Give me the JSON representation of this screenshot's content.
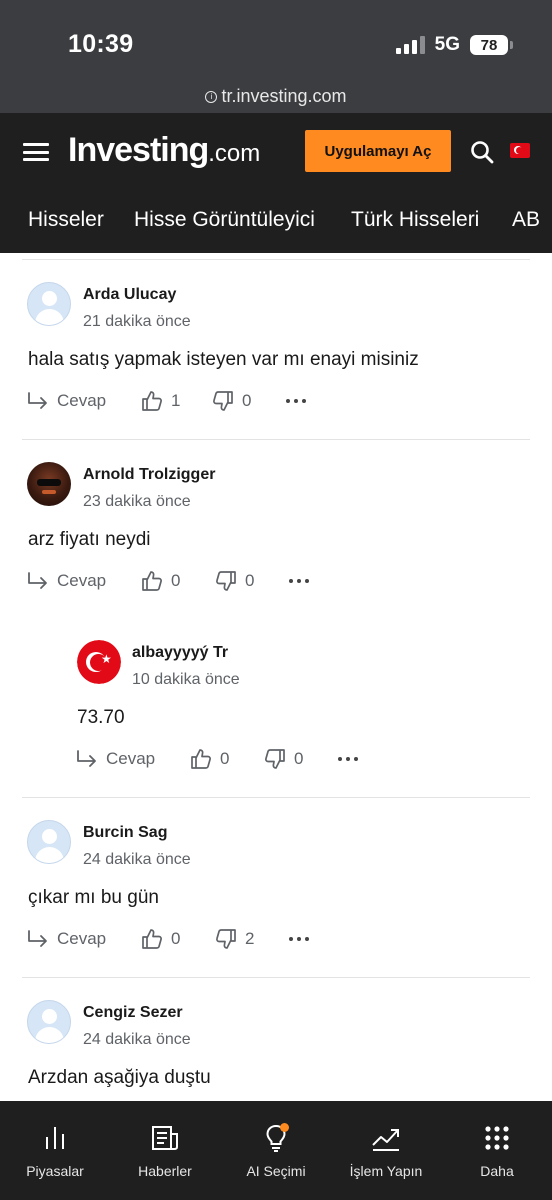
{
  "status_bar": {
    "time": "10:39",
    "network": "5G",
    "battery": "78"
  },
  "browser": {
    "url": "tr.investing.com"
  },
  "header": {
    "logo_main": "Investing",
    "logo_suffix": ".com",
    "open_app_label": "Uygulamayı Aç",
    "accent_color": "#ff8a1f"
  },
  "nav": {
    "items": [
      "Hisseler",
      "Hisse Görüntüleyici",
      "Türk Hisseleri",
      "AB"
    ]
  },
  "comments": [
    {
      "author": "Arda Ulucay",
      "time": "21 dakika önce",
      "text": "hala satış yapmak isteyen var mı enayi misiniz",
      "reply_label": "Cevap",
      "likes": "1",
      "dislikes": "0",
      "avatar": "default-avatar-icon"
    },
    {
      "author": "Arnold Trolzigger",
      "time": "23 dakika önce",
      "text": "arz fiyatı neydi",
      "reply_label": "Cevap",
      "likes": "0",
      "dislikes": "0",
      "avatar": "photo-avatar"
    },
    {
      "author": "albayyyyý Tr",
      "time": "10 dakika önce",
      "text": "73.70",
      "reply_label": "Cevap",
      "likes": "0",
      "dislikes": "0",
      "avatar": "turkish-flag-avatar"
    },
    {
      "author": "Burcin Sag",
      "time": "24 dakika önce",
      "text": "çıkar mı bu gün",
      "reply_label": "Cevap",
      "likes": "0",
      "dislikes": "2",
      "avatar": "default-avatar-icon"
    },
    {
      "author": "Cengiz Sezer",
      "time": "24 dakika önce",
      "text": "Arzdan aşağiya duştu",
      "avatar": "default-avatar-icon"
    }
  ],
  "tab_bar": {
    "items": [
      {
        "label": "Piyasalar",
        "icon": "bar-chart-icon"
      },
      {
        "label": "Haberler",
        "icon": "news-icon"
      },
      {
        "label": "AI Seçimi",
        "icon": "lightbulb-icon"
      },
      {
        "label": "İşlem Yapın",
        "icon": "trend-icon"
      },
      {
        "label": "Daha",
        "icon": "grid-icon"
      }
    ]
  }
}
